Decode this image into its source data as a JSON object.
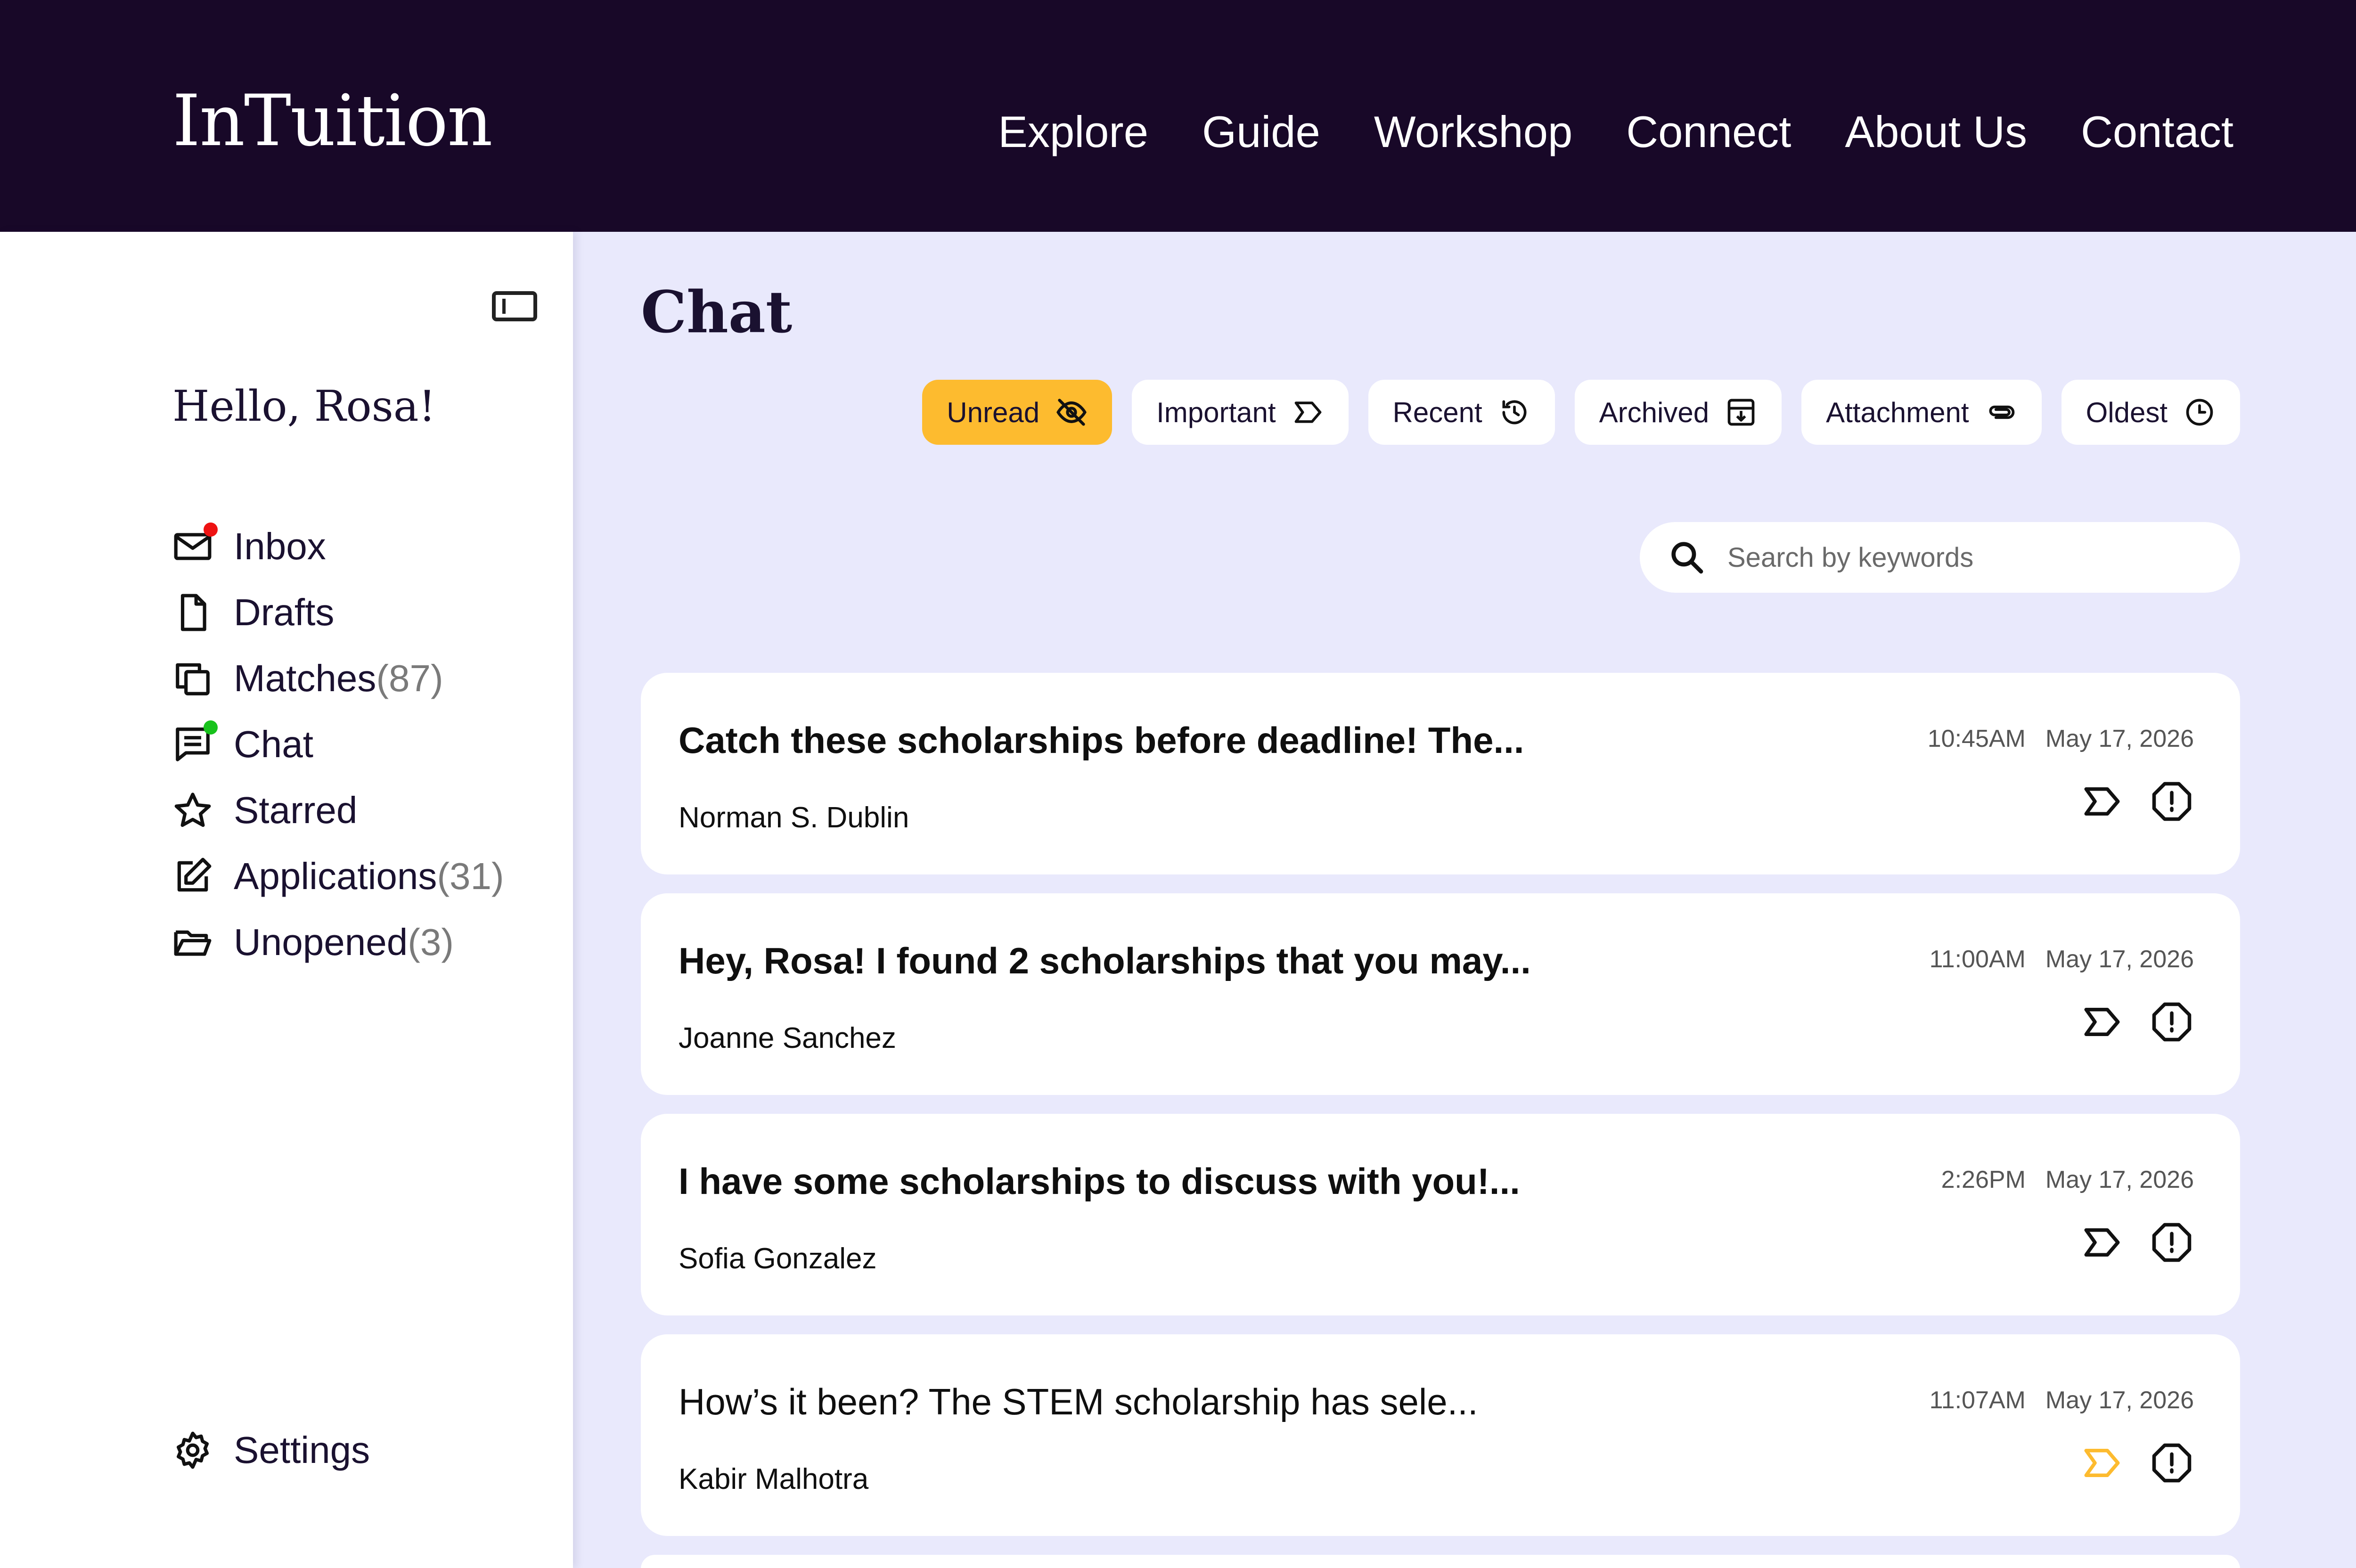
{
  "header": {
    "brand": "InTuition",
    "nav": [
      "Explore",
      "Guide",
      "Workshop",
      "Connect",
      "About Us",
      "Contact"
    ]
  },
  "sidebar": {
    "greeting": "Hello, Rosa!",
    "items": [
      {
        "label": "Inbox",
        "count": "",
        "icon": "mail-icon",
        "dot": "red"
      },
      {
        "label": "Drafts",
        "count": "",
        "icon": "file-icon"
      },
      {
        "label": "Matches",
        "count": "(87)",
        "icon": "copy-icon"
      },
      {
        "label": "Chat",
        "count": "",
        "icon": "chat-icon",
        "dot": "green"
      },
      {
        "label": "Starred",
        "count": "",
        "icon": "star-icon"
      },
      {
        "label": "Applications",
        "count": "(31)",
        "icon": "edit-icon"
      },
      {
        "label": "Unopened",
        "count": "(3)",
        "icon": "folder-open-icon"
      }
    ],
    "settings": "Settings"
  },
  "main": {
    "title": "Chat",
    "filters": [
      {
        "label": "Unread",
        "icon": "eye-off-icon",
        "active": true
      },
      {
        "label": "Important",
        "icon": "label-icon",
        "active": false
      },
      {
        "label": "Recent",
        "icon": "history-icon",
        "active": false
      },
      {
        "label": "Archived",
        "icon": "archive-icon",
        "active": false
      },
      {
        "label": "Attachment",
        "icon": "paperclip-icon",
        "active": false
      },
      {
        "label": "Oldest",
        "icon": "clock-icon",
        "active": false
      }
    ],
    "search": {
      "placeholder": "Search by keywords",
      "value": ""
    },
    "messages": [
      {
        "subject": "Catch these scholarships before deadline! The...",
        "sender": "Norman S. Dublin",
        "time": "10:45AM",
        "date": "May 17, 2026",
        "unread": true,
        "important": false
      },
      {
        "subject": "Hey, Rosa! I found 2 scholarships that you may...",
        "sender": "Joanne Sanchez",
        "time": "11:00AM",
        "date": "May 17, 2026",
        "unread": true,
        "important": false
      },
      {
        "subject": "I have some scholarships to discuss with you!...",
        "sender": "Sofia Gonzalez",
        "time": "2:26PM",
        "date": "May 17, 2026",
        "unread": true,
        "important": false
      },
      {
        "subject": "How’s it been? The STEM scholarship has sele...",
        "sender": "Kabir Malhotra",
        "time": "11:07AM",
        "date": "May 17, 2026",
        "unread": false,
        "important": true
      }
    ]
  },
  "colors": {
    "header_bg": "#180828",
    "main_bg": "#e9e9fc",
    "accent": "#fdbb2f",
    "unread_dot": "#ee1212",
    "online_dot": "#18c21c"
  }
}
